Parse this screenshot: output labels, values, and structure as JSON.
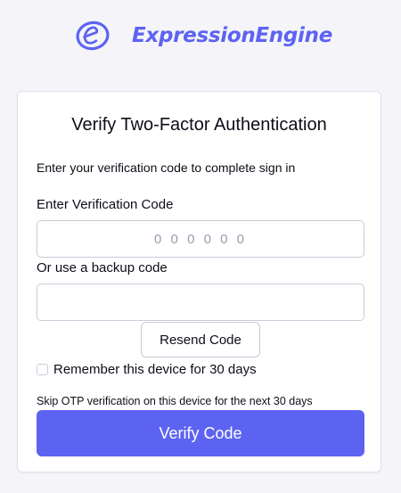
{
  "brand": {
    "name": "ExpressionEngine",
    "logo_icon": "expressionengine-e-logo-icon",
    "color": "#5d63f1"
  },
  "form": {
    "title": "Verify Two-Factor Authentication",
    "intro": "Enter your verification code to complete sign in",
    "code_label": "Enter Verification Code",
    "code_value": "",
    "code_placeholder": "0 0 0 0 0 0",
    "backup_label": "Or use a backup code",
    "backup_value": "",
    "backup_placeholder": "",
    "resend_label": "Resend Code",
    "remember_label": "Remember this device for 30 days",
    "remember_checked": false,
    "skip_note": "Skip OTP verification on this device for the next 30 days",
    "submit_label": "Verify Code"
  }
}
